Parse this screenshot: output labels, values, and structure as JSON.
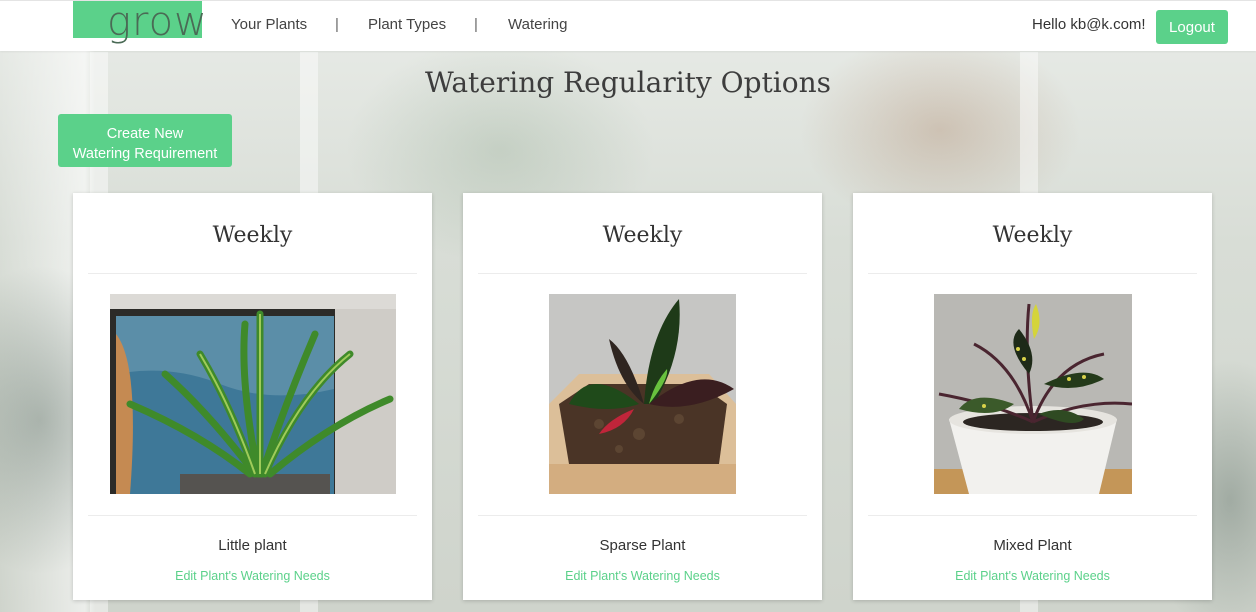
{
  "app": {
    "logo_text": "grow"
  },
  "nav": {
    "links": [
      {
        "label": "Your Plants"
      },
      {
        "label": "Plant Types"
      },
      {
        "label": "Watering"
      }
    ],
    "separator": "|",
    "greeting": "Hello kb@k.com!",
    "logout_label": "Logout"
  },
  "page": {
    "title": "Watering Regularity Options",
    "create_button_line1": "Create New",
    "create_button_line2": "Watering Requirement"
  },
  "cards": [
    {
      "frequency": "Weekly",
      "plant_name": "Little plant",
      "edit_link": "Edit Plant's Watering Needs",
      "image": "plant-photo-dracaena"
    },
    {
      "frequency": "Weekly",
      "plant_name": "Sparse Plant",
      "edit_link": "Edit Plant's Watering Needs",
      "image": "plant-photo-croton-pot"
    },
    {
      "frequency": "Weekly",
      "plant_name": "Mixed Plant",
      "edit_link": "Edit Plant's Watering Needs",
      "image": "plant-photo-croton-white-pot"
    }
  ],
  "colors": {
    "accent": "#5bd18a",
    "text": "#333333"
  }
}
